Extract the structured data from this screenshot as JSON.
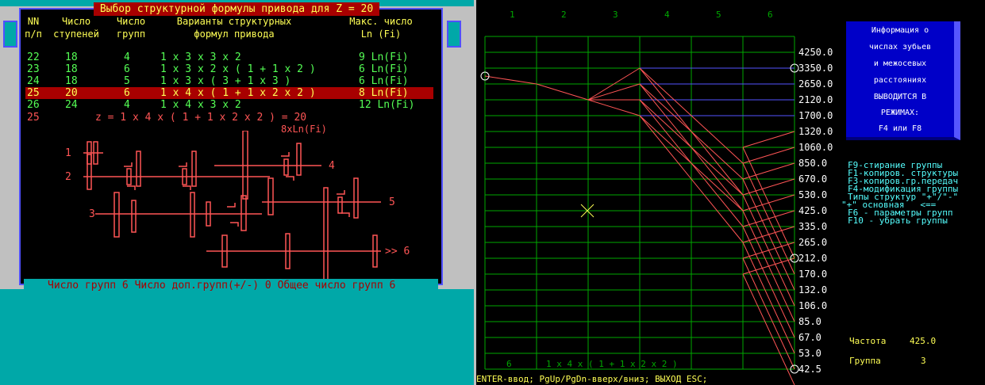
{
  "left": {
    "title": "Выбор структурной формулы привода для Z = 20",
    "headers": {
      "nn": [
        "NN",
        "п/п"
      ],
      "steps": [
        "Число",
        "ступеней"
      ],
      "groups": [
        "Число",
        "групп"
      ],
      "variants": [
        "Варианты структурных",
        "формул привода"
      ],
      "max": [
        "Макс. число",
        "Ln (Fi)"
      ]
    },
    "rows": [
      {
        "nn": "22",
        "steps": "18",
        "groups": "4",
        "formula": "1 x 3 x 3 x 2",
        "max": "9 Ln(Fi)"
      },
      {
        "nn": "23",
        "steps": "18",
        "groups": "6",
        "formula": "1 x 3 x 2 x ( 1 + 1 x 2 )",
        "max": "6 Ln(Fi)"
      },
      {
        "nn": "24",
        "steps": "18",
        "groups": "5",
        "formula": "1 x 3 x ( 3 + 1 x 3 )",
        "max": "6 Ln(Fi)"
      },
      {
        "nn": "25",
        "steps": "20",
        "groups": "6",
        "formula": "1 x 4 x ( 1 + 1 x 2 x 2 )",
        "max": "8 Ln(Fi)"
      },
      {
        "nn": "26",
        "steps": "24",
        "groups": "4",
        "formula": "1 x 4 x 3 x 2",
        "max": "12 Ln(Fi)"
      }
    ],
    "selected_nn": "25",
    "summary_nn": "25",
    "summary_formula": "z = 1 x 4 x ( 1 + 1 x 2 x 2 ) = 20",
    "summary_max": "8xLn(Fi)",
    "shaft_labels": [
      "1",
      "2",
      "3",
      "4",
      "5",
      ">> 6"
    ],
    "status": "Число групп 6 Число доп.групп(+/-) 0 Общее число групп 6"
  },
  "right": {
    "columns": [
      "1",
      "2",
      "3",
      "4",
      "5",
      "6"
    ],
    "y_labels": [
      "4250.0",
      "3350.0",
      "2650.0",
      "2120.0",
      "1700.0",
      "1320.0",
      "1060.0",
      "850.0",
      "670.0",
      "530.0",
      "425.0",
      "335.0",
      "265.0",
      "212.0",
      "170.0",
      "132.0",
      "106.0",
      "85.0",
      "67.0",
      "53.0",
      "42.5"
    ],
    "bottom_num": "6",
    "bottom_formula": "1 x 4 x ( 1 + 1 x 2 x 2 )",
    "info_lines": [
      "Информация о",
      "числах зубьев",
      "и межосевых",
      "расстояниях",
      "ВЫВОДИТСЯ В",
      "РЕЖИМАХ:",
      "F4 или F8"
    ],
    "help_lines": [
      "F9-стирание группы",
      "F1-копиров. структуры",
      "F3-копиров.гр.передач",
      "F4-модификация группы",
      "Типы структур \"+\"/\"-\"",
      "\"+\" основная   <==",
      "F6 - параметры групп",
      "F10 - убрать группы"
    ],
    "freq_label": "Частота",
    "freq_value": "425.0",
    "group_label": "Группа",
    "group_value": "3",
    "status": "ENTER-ввод; PgUp/PgDn-вверх/вниз; ВЫХОД ESC;"
  },
  "colors": {
    "grid": "#00a800",
    "red": "#ff5555",
    "blue": "#5555ff",
    "yellow": "#ffff55",
    "green": "#55ff55",
    "cyan": "#00a8a8"
  }
}
